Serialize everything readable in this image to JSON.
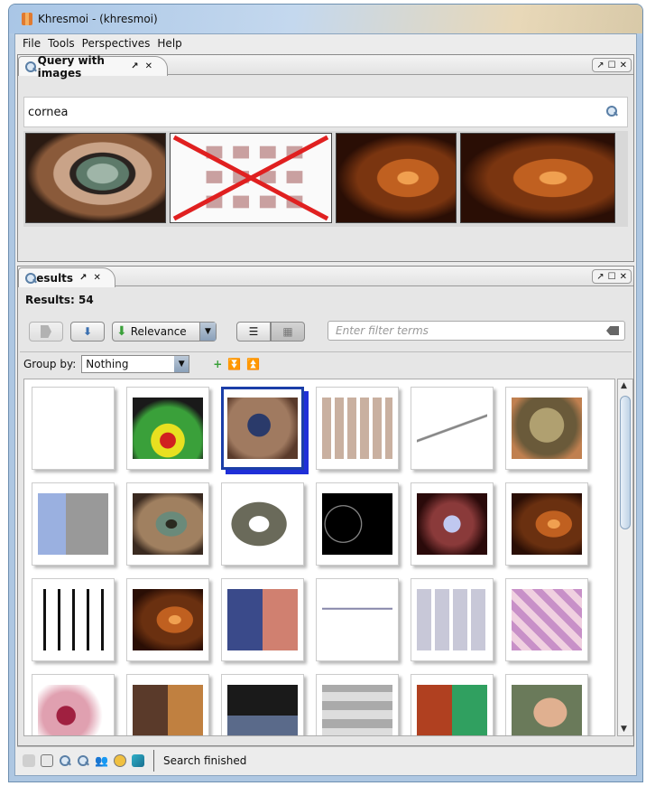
{
  "window": {
    "title": "Khresmoi - (khresmoi)"
  },
  "menu": [
    "File",
    "Tools",
    "Perspectives",
    "Help"
  ],
  "query_panel": {
    "tab_label": "Query with images",
    "search_value": "cornea",
    "images": [
      "eye-cornea-green",
      "crossed-out-figure-grid",
      "eye-brown-iris",
      "eye-brown-iris-wide"
    ]
  },
  "results_panel": {
    "tab_label": "Results",
    "results_text": "Results: 54",
    "sort_label": "Relevance",
    "filter_placeholder": "Enter filter terms",
    "group_by_label": "Group by:",
    "group_by_value": "Nothing"
  },
  "thumbnails": [
    "document-chart",
    "eye-green-laser",
    "eye-blue-closeup",
    "figure-grid",
    "scatter-plot",
    "eye-lens-cataract",
    "microscopy-panels",
    "eye-green-iris",
    "diagram-lens",
    "dark-ring-scan",
    "eye-red-glow",
    "eye-brown-iris",
    "bar-chart-doc",
    "eye-brown-iris",
    "eye-pair-blue",
    "line-plot",
    "histology-grid",
    "histology-pink",
    "eye-red-lid",
    "eye-pair-colored",
    "eye-collage",
    "microscopy-gray",
    "eye-green-fluorescent",
    "man-with-device"
  ],
  "status": {
    "text": "Search finished"
  },
  "colors": {
    "selection": "#1b3ea8",
    "accent_green": "#3aa03a"
  }
}
